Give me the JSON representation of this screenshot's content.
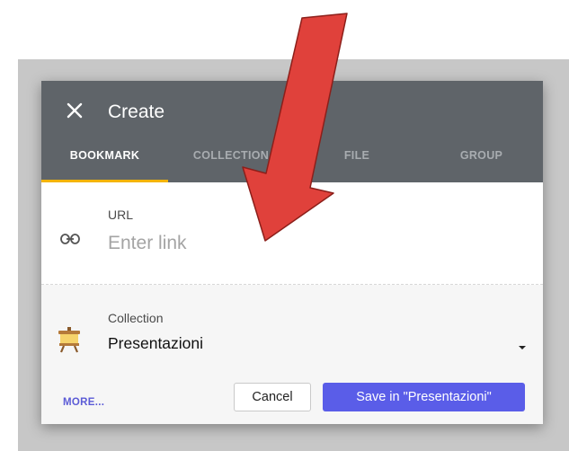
{
  "dialog": {
    "title": "Create",
    "close_icon": "close-icon"
  },
  "tabs": [
    {
      "label": "BOOKMARK",
      "active": true
    },
    {
      "label": "COLLECTION",
      "active": false
    },
    {
      "label": "FILE",
      "active": false
    },
    {
      "label": "GROUP",
      "active": false
    }
  ],
  "url_field": {
    "label": "URL",
    "placeholder": "Enter link",
    "value": "",
    "icon": "link-icon"
  },
  "collection_field": {
    "label": "Collection",
    "value": "Presentazioni",
    "icon": "presentation-board-icon"
  },
  "actions": {
    "more_label": "MORE...",
    "cancel_label": "Cancel",
    "save_label": "Save in \"Presentazioni\""
  },
  "colors": {
    "header_bg": "#5f6469",
    "active_tab_underline": "#f4b400",
    "primary_button": "#5a5de8",
    "more_link": "#5b5bd6",
    "annotation_arrow": "#e0413b"
  },
  "annotation": {
    "icon": "pointer-arrow-annotation"
  }
}
